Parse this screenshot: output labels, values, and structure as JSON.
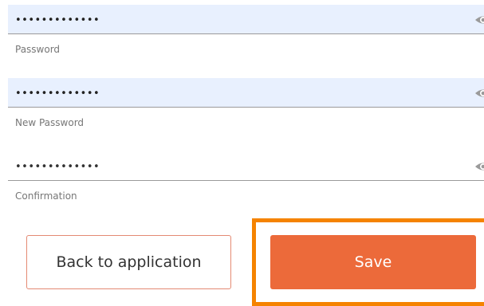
{
  "form": {
    "fields": [
      {
        "label": "Password",
        "value": "•••••••••••••",
        "icon": "eye-icon",
        "autofilled": true
      },
      {
        "label": "New Password",
        "value": "•••••••••••••",
        "icon": "eye-icon",
        "autofilled": true
      },
      {
        "label": "Confirmation",
        "value": "•••••••••••••",
        "icon": "eye-icon",
        "autofilled": false
      }
    ]
  },
  "actions": {
    "back_label": "Back to application",
    "save_label": "Save"
  },
  "colors": {
    "autofill_bg": "#e8f0fe",
    "primary": "#ec6a3a",
    "secondary_border": "#e48a73",
    "focus_ring": "#f58300"
  }
}
